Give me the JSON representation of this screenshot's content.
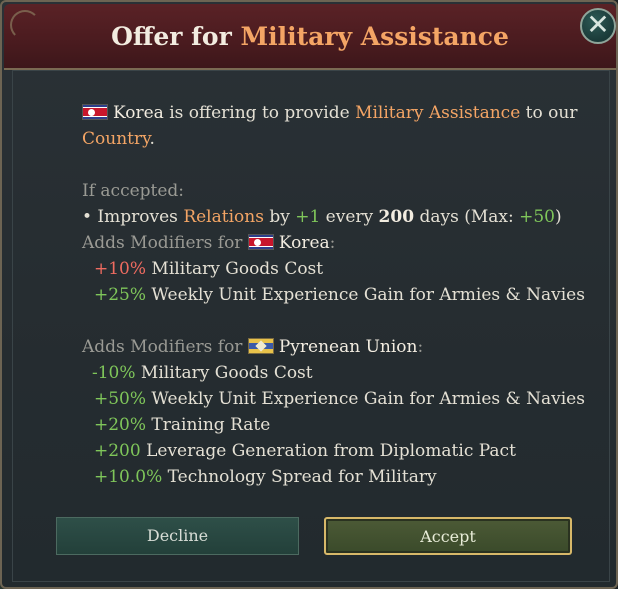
{
  "dialog": {
    "title_prefix": "Offer for ",
    "title_highlight": "Military Assistance",
    "close_icon": "close-icon"
  },
  "intro": {
    "country": "Korea",
    "text1": " is offering to provide ",
    "highlight": "Military Assistance",
    "text2": " to our",
    "text3": "Country",
    "text4": "."
  },
  "if_accepted": {
    "label": "If accepted:",
    "bullet_a": "• Improves ",
    "relations": "Relations",
    "by": " by ",
    "amount": "+1",
    "every": " every ",
    "days_num": "200",
    "days_text": " days (Max: ",
    "max": "+50",
    "close_paren": ")"
  },
  "korea_mods": {
    "label": "Adds Modifiers for ",
    "country": "Korea",
    "colon": ":",
    "items": [
      {
        "value": "+10%",
        "text": " Military Goods Cost"
      },
      {
        "value": "+25%",
        "text": " Weekly Unit Experience Gain for Armies & Navies"
      }
    ]
  },
  "pyrenean_mods": {
    "label": "Adds Modifiers for ",
    "country": "Pyrenean Union",
    "colon": ":",
    "items": [
      {
        "value": "-10%",
        "text": " Military Goods Cost"
      },
      {
        "value": "+50%",
        "text": " Weekly Unit Experience Gain for Armies & Navies"
      },
      {
        "value": "+20%",
        "text": " Training Rate"
      },
      {
        "value": "+200",
        "text": " Leverage Generation from Diplomatic Pact"
      },
      {
        "value": "+10.0%",
        "text": " Technology Spread for Military"
      }
    ]
  },
  "buttons": {
    "decline": "Decline",
    "accept": "Accept"
  },
  "colors": {
    "title_bar": "#4a1b1f",
    "highlight": "#f4a565",
    "positive": "#7fc65a",
    "negative": "#ee6b60",
    "accept_border": "#d7b869"
  }
}
